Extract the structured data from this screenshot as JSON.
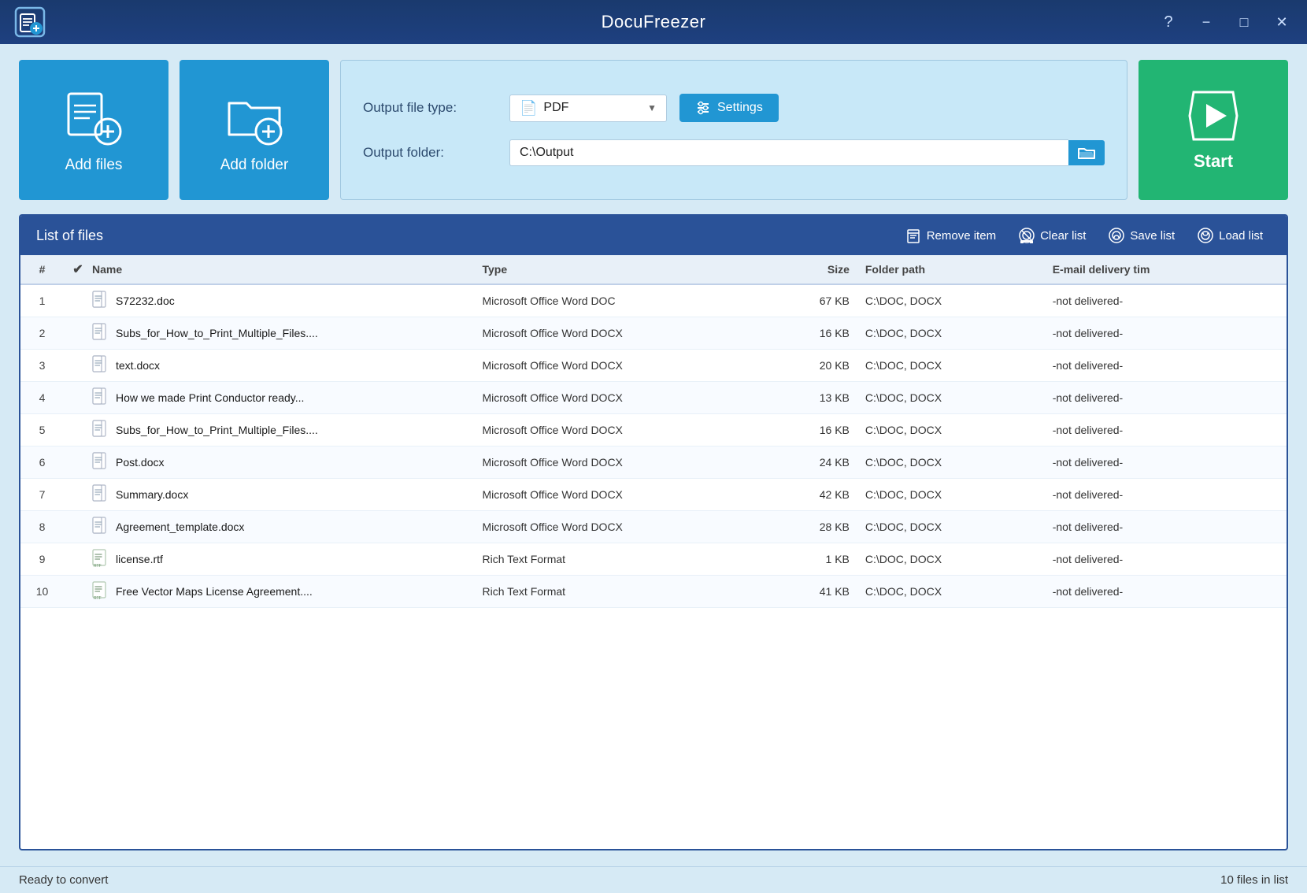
{
  "titlebar": {
    "title": "DocuFreezer",
    "help_label": "?",
    "minimize_label": "−",
    "maximize_label": "□",
    "close_label": "✕"
  },
  "toolbar": {
    "add_files_label": "Add files",
    "add_folder_label": "Add folder",
    "output_file_type_label": "Output file type:",
    "output_folder_label": "Output folder:",
    "output_type_value": "PDF",
    "settings_label": "Settings",
    "output_folder_value": "C:\\Output",
    "start_label": "Start"
  },
  "file_list": {
    "title": "List of files",
    "remove_item_label": "Remove item",
    "clear_list_label": "Clear list",
    "save_list_label": "Save list",
    "load_list_label": "Load list",
    "columns": {
      "num": "#",
      "check": "✔",
      "name": "Name",
      "type": "Type",
      "size": "Size",
      "folder": "Folder path",
      "email": "E-mail delivery tim"
    },
    "rows": [
      {
        "num": "1",
        "name": "S72232.doc",
        "type": "Microsoft Office Word DOC",
        "size": "67 KB",
        "folder": "C:\\DOC, DOCX",
        "email": "-not delivered-",
        "icon": "doc"
      },
      {
        "num": "2",
        "name": "Subs_for_How_to_Print_Multiple_Files....",
        "type": "Microsoft Office Word DOCX",
        "size": "16 KB",
        "folder": "C:\\DOC, DOCX",
        "email": "-not delivered-",
        "icon": "docx"
      },
      {
        "num": "3",
        "name": "text.docx",
        "type": "Microsoft Office Word DOCX",
        "size": "20 KB",
        "folder": "C:\\DOC, DOCX",
        "email": "-not delivered-",
        "icon": "docx"
      },
      {
        "num": "4",
        "name": "How we made Print Conductor ready...",
        "type": "Microsoft Office Word DOCX",
        "size": "13 KB",
        "folder": "C:\\DOC, DOCX",
        "email": "-not delivered-",
        "icon": "docx"
      },
      {
        "num": "5",
        "name": "Subs_for_How_to_Print_Multiple_Files....",
        "type": "Microsoft Office Word DOCX",
        "size": "16 KB",
        "folder": "C:\\DOC, DOCX",
        "email": "-not delivered-",
        "icon": "docx"
      },
      {
        "num": "6",
        "name": "Post.docx",
        "type": "Microsoft Office Word DOCX",
        "size": "24 KB",
        "folder": "C:\\DOC, DOCX",
        "email": "-not delivered-",
        "icon": "docx"
      },
      {
        "num": "7",
        "name": "Summary.docx",
        "type": "Microsoft Office Word DOCX",
        "size": "42 KB",
        "folder": "C:\\DOC, DOCX",
        "email": "-not delivered-",
        "icon": "docx"
      },
      {
        "num": "8",
        "name": "Agreement_template.docx",
        "type": "Microsoft Office Word DOCX",
        "size": "28 KB",
        "folder": "C:\\DOC, DOCX",
        "email": "-not delivered-",
        "icon": "docx"
      },
      {
        "num": "9",
        "name": "license.rtf",
        "type": "Rich Text Format",
        "size": "1 KB",
        "folder": "C:\\DOC, DOCX",
        "email": "-not delivered-",
        "icon": "rtf"
      },
      {
        "num": "10",
        "name": "Free Vector Maps License Agreement....",
        "type": "Rich Text Format",
        "size": "41 KB",
        "folder": "C:\\DOC, DOCX",
        "email": "-not delivered-",
        "icon": "rtf"
      }
    ]
  },
  "statusbar": {
    "status": "Ready to convert",
    "count": "10 files in list"
  }
}
